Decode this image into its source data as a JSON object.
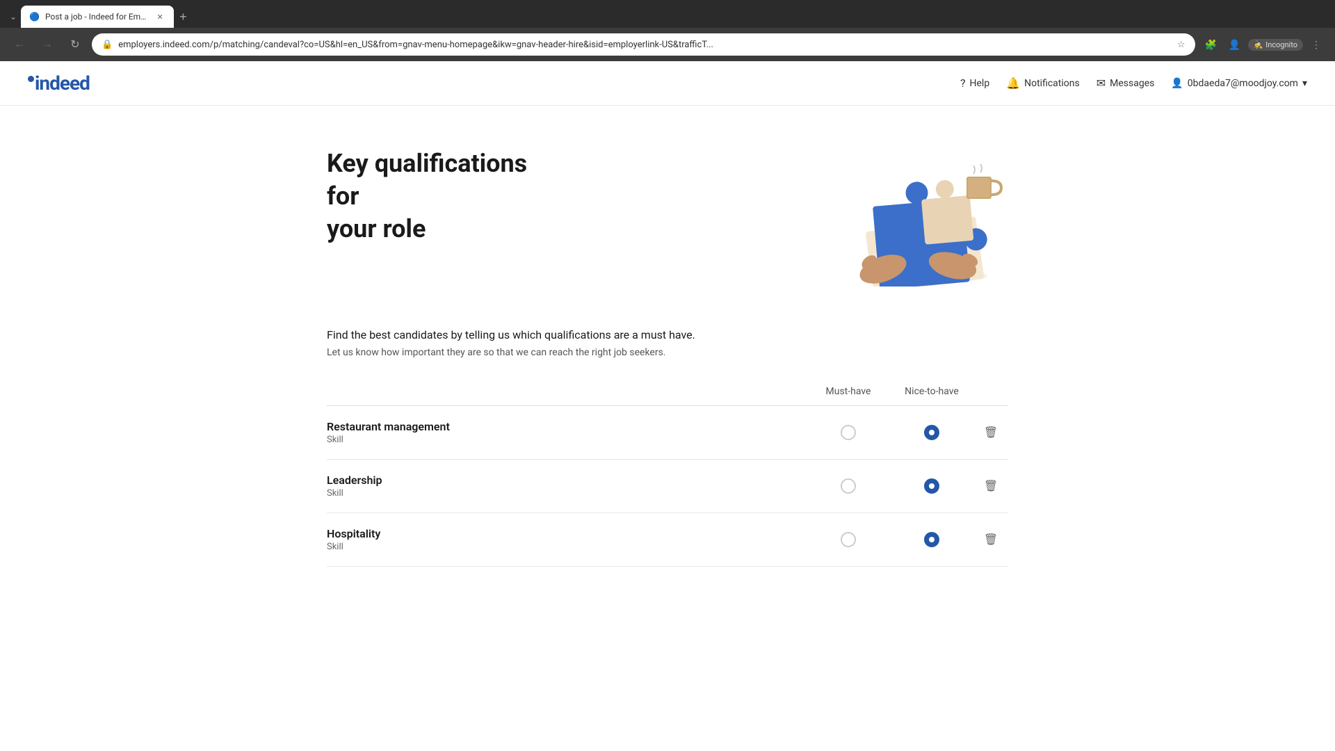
{
  "browser": {
    "tab_title": "Post a job - Indeed for Employ...",
    "url": "employers.indeed.com/p/matching/candeval?co=US&hl=en_US&from=gnav-menu-homepage&ikw=gnav-header-hire&isid=employerlink-US&trafficT...",
    "incognito_label": "Incognito"
  },
  "header": {
    "logo_text": "indeed",
    "nav_help": "Help",
    "nav_notifications": "Notifications",
    "nav_messages": "Messages",
    "nav_user": "0bdaeda7@moodjoy.com"
  },
  "hero": {
    "title_line1": "Key qualifications for",
    "title_line2": "your role"
  },
  "description": {
    "main_text": "Find the best candidates by telling us which qualifications are a must have.",
    "sub_text": "Let us know how important they are so that we can reach the right job seekers."
  },
  "table": {
    "col_must_have": "Must-have",
    "col_nice_to_have": "Nice-to-have",
    "qualifications": [
      {
        "name": "Restaurant management",
        "type": "Skill",
        "must_have": false,
        "nice_to_have": true
      },
      {
        "name": "Leadership",
        "type": "Skill",
        "must_have": false,
        "nice_to_have": true
      },
      {
        "name": "Hospitality",
        "type": "Skill",
        "must_have": false,
        "nice_to_have": true
      }
    ]
  }
}
